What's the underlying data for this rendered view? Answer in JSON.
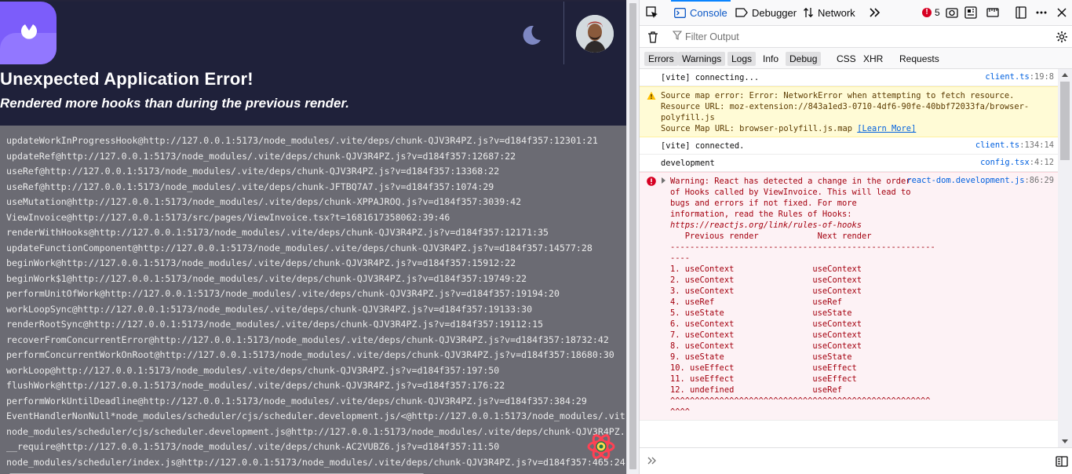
{
  "app": {
    "error_title": "Unexpected Application Error!",
    "error_message": "Rendered more hooks than during the previous render.",
    "stack": [
      "updateWorkInProgressHook@http://127.0.0.1:5173/node_modules/.vite/deps/chunk-QJV3R4PZ.js?v=d184f357:12301:21",
      "updateRef@http://127.0.0.1:5173/node_modules/.vite/deps/chunk-QJV3R4PZ.js?v=d184f357:12687:22",
      "useRef@http://127.0.0.1:5173/node_modules/.vite/deps/chunk-QJV3R4PZ.js?v=d184f357:13368:22",
      "useRef@http://127.0.0.1:5173/node_modules/.vite/deps/chunk-JFTBQ7A7.js?v=d184f357:1074:29",
      "useMutation@http://127.0.0.1:5173/node_modules/.vite/deps/chunk-XPPAJROQ.js?v=d184f357:3039:42",
      "ViewInvoice@http://127.0.0.1:5173/src/pages/ViewInvoice.tsx?t=1681617358062:39:46",
      "renderWithHooks@http://127.0.0.1:5173/node_modules/.vite/deps/chunk-QJV3R4PZ.js?v=d184f357:12171:35",
      "updateFunctionComponent@http://127.0.0.1:5173/node_modules/.vite/deps/chunk-QJV3R4PZ.js?v=d184f357:14577:28",
      "beginWork@http://127.0.0.1:5173/node_modules/.vite/deps/chunk-QJV3R4PZ.js?v=d184f357:15912:22",
      "beginWork$1@http://127.0.0.1:5173/node_modules/.vite/deps/chunk-QJV3R4PZ.js?v=d184f357:19749:22",
      "performUnitOfWork@http://127.0.0.1:5173/node_modules/.vite/deps/chunk-QJV3R4PZ.js?v=d184f357:19194:20",
      "workLoopSync@http://127.0.0.1:5173/node_modules/.vite/deps/chunk-QJV3R4PZ.js?v=d184f357:19133:30",
      "renderRootSync@http://127.0.0.1:5173/node_modules/.vite/deps/chunk-QJV3R4PZ.js?v=d184f357:19112:15",
      "recoverFromConcurrentError@http://127.0.0.1:5173/node_modules/.vite/deps/chunk-QJV3R4PZ.js?v=d184f357:18732:42",
      "performConcurrentWorkOnRoot@http://127.0.0.1:5173/node_modules/.vite/deps/chunk-QJV3R4PZ.js?v=d184f357:18680:30",
      "workLoop@http://127.0.0.1:5173/node_modules/.vite/deps/chunk-QJV3R4PZ.js?v=d184f357:197:50",
      "flushWork@http://127.0.0.1:5173/node_modules/.vite/deps/chunk-QJV3R4PZ.js?v=d184f357:176:22",
      "performWorkUntilDeadline@http://127.0.0.1:5173/node_modules/.vite/deps/chunk-QJV3R4PZ.js?v=d184f357:384:29",
      "EventHandlerNonNull*node_modules/scheduler/cjs/scheduler.development.js/<@http://127.0.0.1:5173/node_modules/.vit",
      "node_modules/scheduler/cjs/scheduler.development.js@http://127.0.0.1:5173/node_modules/.vite/deps/chunk-QJV3R4PZ.",
      "__require@http://127.0.0.1:5173/node_modules/.vite/deps/chunk-AC2VUBZ6.js?v=d184f357:11:50",
      "node_modules/scheduler/index.js@http://127.0.0.1:5173/node_modules/.vite/deps/chunk-QJV3R4PZ.js?v=d184f357:465:24"
    ]
  },
  "devtools": {
    "tabs": [
      "Console",
      "Debugger",
      "Network"
    ],
    "error_count": "5",
    "filter_placeholder": "Filter Output",
    "levels": [
      "Errors",
      "Warnings",
      "Logs",
      "Info",
      "Debug"
    ],
    "request_types": [
      "CSS",
      "XHR",
      "Requests"
    ],
    "messages": {
      "m1": {
        "text": "[vite] connecting...",
        "src": "client.ts",
        "line": ":19:8"
      },
      "m2": {
        "lines": [
          "Source map error: Error: NetworkError when attempting to fetch resource.",
          "Resource URL: moz-extension://843a1ed3-0710-4df6-90fe-40bbf72033fa/browser-",
          "polyfill.js",
          "Source Map URL: browser-polyfill.js.map "
        ],
        "link": "[Learn More]"
      },
      "m3": {
        "text": "[vite] connected.",
        "src": "client.ts",
        "line": ":134:14"
      },
      "m4": {
        "text": "development",
        "src": "config.tsx",
        "line": ":4:12"
      },
      "m5": {
        "src": "react-dom.development.js",
        "line": ":86:29",
        "lines": [
          "Warning: React has detected a change in the order",
          "of Hooks called by ViewInvoice. This will lead to",
          "bugs and errors if not fixed. For more",
          "information, read the Rules of Hooks:"
        ],
        "link": "https://reactjs.org/link/rules-of-hooks",
        "table": [
          "",
          "   Previous render            Next render",
          "",
          "------------------------------------------------------",
          "----",
          "1. useContext                useContext",
          "2. useContext                useContext",
          "3. useContext                useContext",
          "4. useRef                    useRef",
          "5. useState                  useState",
          "6. useContext                useContext",
          "7. useContext                useContext",
          "8. useContext                useContext",
          "9. useState                  useState",
          "10. useEffect                useEffect",
          "11. useEffect                useEffect",
          "12. undefined                useRef",
          "",
          "^^^^^^^^^^^^^^^^^^^^^^^^^^^^^^^^^^^^^^^^^^^^^^^^^^^^^",
          "^^^^"
        ]
      }
    },
    "colors": {
      "accent": "#7c5dfa",
      "header": "#1f213a",
      "error": "#d70022",
      "warning": "#fffbd6"
    }
  }
}
